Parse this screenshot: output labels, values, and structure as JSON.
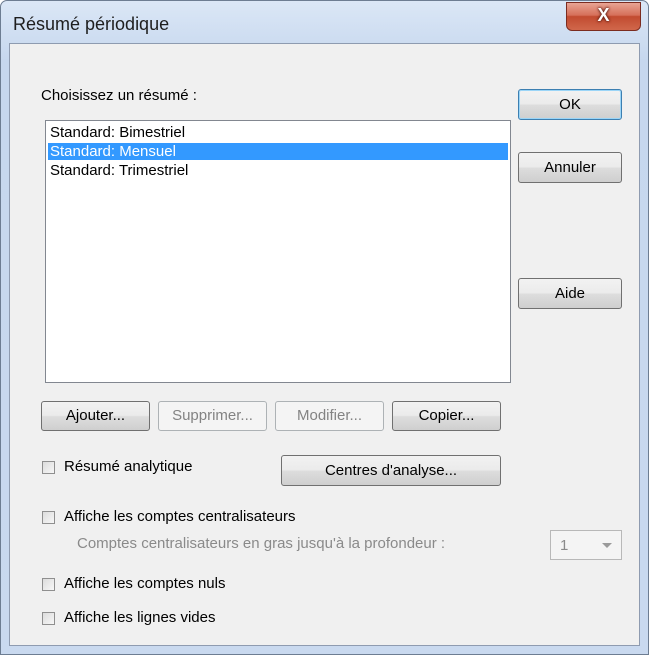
{
  "window": {
    "title": "Résumé périodique",
    "close_glyph": "X"
  },
  "summary": {
    "label": "Choisissez un résumé :",
    "items": [
      {
        "label": "Standard: Bimestriel",
        "selected": false
      },
      {
        "label": "Standard: Mensuel",
        "selected": true
      },
      {
        "label": "Standard: Trimestriel",
        "selected": false
      }
    ]
  },
  "side_buttons": {
    "ok": "OK",
    "cancel": "Annuler",
    "help": "Aide"
  },
  "list_buttons": {
    "add": "Ajouter...",
    "delete": "Supprimer...",
    "edit": "Modifier...",
    "copy": "Copier..."
  },
  "options": {
    "analytic": {
      "label": "Résumé analytique",
      "checked": false
    },
    "centers_button": "Centres d'analyse...",
    "show_central_accounts": {
      "label": "Affiche les comptes centralisateurs",
      "checked": false
    },
    "bold_depth": {
      "label": "Comptes centralisateurs en gras jusqu'à la profondeur :",
      "value": "1"
    },
    "show_zero_accounts": {
      "label": "Affiche les comptes nuls",
      "checked": false
    },
    "show_empty_lines": {
      "label": "Affiche les lignes vides",
      "checked": false
    }
  },
  "colors": {
    "selection": "#3399ff",
    "close_button": "#c24b30"
  },
  "icons": {
    "close": "close-icon",
    "dropdown": "chevron-down-icon",
    "checkbox": "checkbox-icon"
  }
}
